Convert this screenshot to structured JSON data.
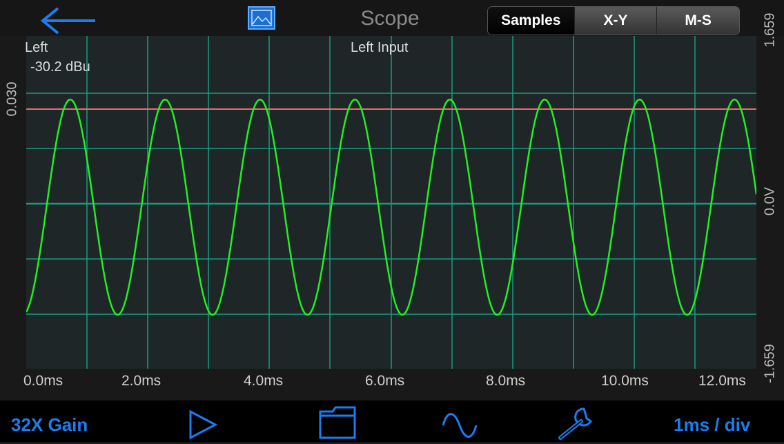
{
  "header": {
    "title": "Scope",
    "segments": [
      "Samples",
      "X-Y",
      "M-S"
    ],
    "selected_segment": "Samples"
  },
  "plot": {
    "channel_name": "Left",
    "channel_level": "-30.2 dBu",
    "source_label": "Left Input",
    "left_axis_label": "0.030",
    "right_axis_top": "1.659",
    "right_axis_mid": "0.0V",
    "right_axis_bottom": "-1.659",
    "x_ticks": [
      "0.0ms",
      "2.0ms",
      "4.0ms",
      "6.0ms",
      "8.0ms",
      "10.0ms",
      "12.0ms"
    ],
    "trace_color": "#22ee22",
    "grid_color": "#1a9a80",
    "trigger_line_color": "#e07070"
  },
  "toolbar": {
    "gain_label": "32X Gain",
    "timebase_label": "1ms / div",
    "icons": [
      "play-icon",
      "folder-icon",
      "sine-wave-icon",
      "wrench-icon"
    ]
  }
}
